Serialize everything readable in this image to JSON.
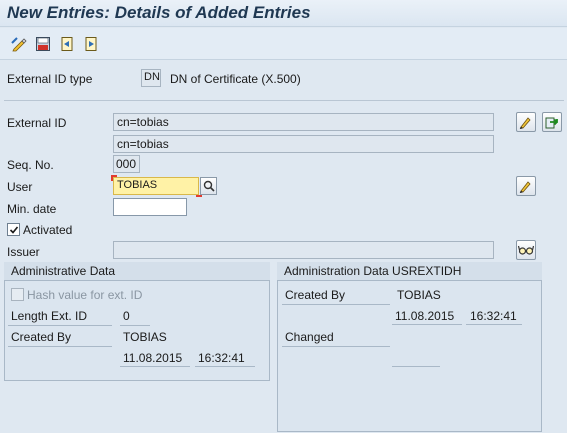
{
  "window": {
    "title": "New Entries: Details of Added Entries"
  },
  "toolbar": {
    "icons": [
      "display-change-icon",
      "save-icon",
      "previous-entry-icon",
      "next-entry-icon"
    ]
  },
  "header": {
    "external_id_type_label": "External ID type",
    "external_id_type_code": "DN",
    "external_id_type_desc": "DN of Certificate (X.500)"
  },
  "form": {
    "external_id_label": "External ID",
    "external_id_value": "cn=tobias",
    "external_id_value2": "cn=tobias",
    "seq_no_label": "Seq. No.",
    "seq_no_value": "000",
    "user_label": "User",
    "user_value": "TOBIAS",
    "min_date_label": "Min. date",
    "min_date_value": "",
    "activated_label": "Activated",
    "activated_checked": true,
    "issuer_label": "Issuer",
    "issuer_value": ""
  },
  "admin_left": {
    "title": "Administrative Data",
    "hash_label": "Hash value for ext. ID",
    "hash_checked": false,
    "length_label": "Length Ext. ID",
    "length_value": "0",
    "created_by_label": "Created By",
    "created_by_value": "TOBIAS",
    "created_date": "11.08.2015",
    "created_time": "16:32:41"
  },
  "admin_right": {
    "title": "Administration Data USREXTIDH",
    "created_by_label": "Created By",
    "created_by_value": "TOBIAS",
    "created_date": "11.08.2015",
    "created_time": "16:32:41",
    "changed_label": "Changed",
    "changed_date": "",
    "changed_time": ""
  },
  "colors": {
    "background": "#dfe8f1",
    "title": "#1f3852",
    "required_field": "#fff2a6",
    "required_marker": "#e23b2e"
  }
}
